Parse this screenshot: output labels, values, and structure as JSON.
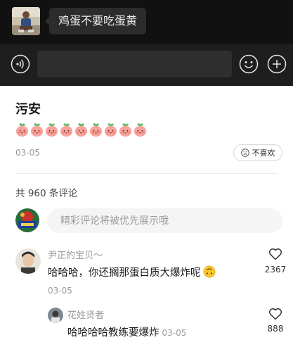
{
  "chat": {
    "avatar_icon": "user-photo-avatar",
    "message": "鸡蛋不要吃蛋黄"
  },
  "input_bar": {
    "voice_icon": "voice-input-icon",
    "emoji_icon": "emoji-icon",
    "plus_icon": "plus-circle-icon"
  },
  "post": {
    "author": "污安",
    "emoji_icon": "peach-face-emoji",
    "emoji_count": 9,
    "date": "03-05",
    "dislike_icon": "frown-face-icon",
    "dislike_label": "不喜欢"
  },
  "comments": {
    "count_label": "共 960 条评论",
    "input_placeholder": "精彩评论将被优先展示哦",
    "items": [
      {
        "name": "尹正的宝贝～",
        "text": "哈哈哈，你还搁那蛋白质大爆炸呢",
        "text_emoji_icon": "upside-down-face-emoji",
        "date": "03-05",
        "likes": "2367"
      },
      {
        "name": "花姓贤者",
        "text": "哈哈哈哈教练要爆炸",
        "date": "03-05",
        "likes": "888"
      }
    ]
  },
  "colors": {
    "chat_background": "#111111",
    "input_bar_background": "#1e1e1e",
    "bubble_background": "#2c2c2c",
    "secondary_text": "#9a9a9a",
    "peach": "#f7a29a"
  }
}
